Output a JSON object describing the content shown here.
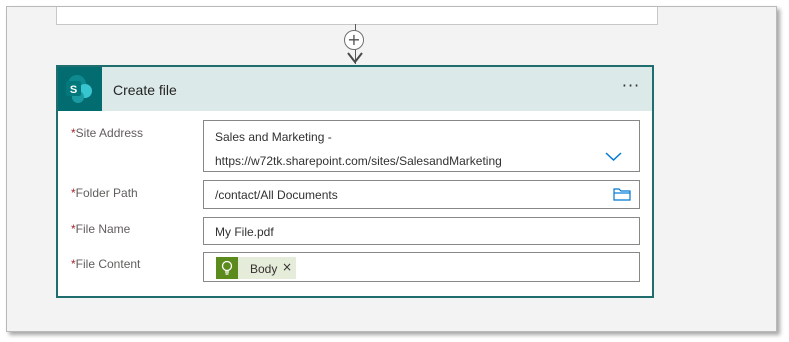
{
  "flow": {
    "add_step_symbol": "+"
  },
  "action_card": {
    "title": "Create file",
    "connector_icon": "sharepoint-icon",
    "connector_letter": "S",
    "more_menu": "···",
    "colors": {
      "header_bg": "#dbe9e9",
      "border": "#1f6d6d",
      "sharepoint_tile": "#036c70",
      "required_asterisk": "#a4262c",
      "dropdown_accent": "#0078d4",
      "token_bg": "#e6ecda",
      "token_icon_bg": "#5b8a1d"
    },
    "fields": {
      "site_address": {
        "required_mark": "*",
        "label": "Site Address",
        "value_line1": "Sales and Marketing -",
        "value_line2": "https://w72tk.sharepoint.com/sites/SalesandMarketing",
        "control_icon": "chevron-down-icon"
      },
      "folder_path": {
        "required_mark": "*",
        "label": "Folder Path",
        "value": "/contact/All Documents",
        "control_icon": "folder-icon"
      },
      "file_name": {
        "required_mark": "*",
        "label": "File Name",
        "value": "My File.pdf"
      },
      "file_content": {
        "required_mark": "*",
        "label": "File Content",
        "token": {
          "label": "Body",
          "icon": "lightbulb-icon",
          "remove_symbol": "×"
        }
      }
    }
  }
}
